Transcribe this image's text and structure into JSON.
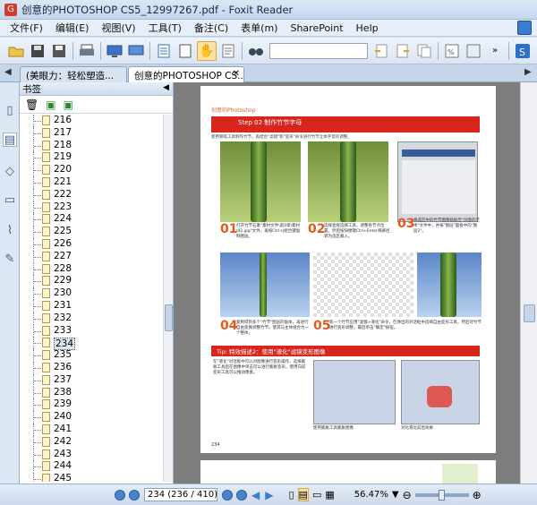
{
  "window": {
    "title": "创意的PHOTOSHOP  CS5_12997267.pdf - Foxit Reader"
  },
  "menu": {
    "items": [
      "文件(F)",
      "编辑(E)",
      "视图(V)",
      "工具(T)",
      "备注(C)",
      "表单(m)",
      "SharePoint",
      "Help"
    ]
  },
  "toolbar": {
    "icons": [
      "open-folder-icon",
      "save-icon",
      "save-as-icon",
      "print-icon",
      "screen-icon",
      "display-icon",
      "document-icon",
      "page-icon",
      "hand-tool-icon",
      "select-text-icon",
      "find-icon",
      "search-input",
      "previous-result-icon",
      "next-result-icon",
      "copy-icon",
      "zoom-in-icon",
      "view-icon",
      "sharepoint-icon"
    ],
    "search_value": ""
  },
  "tabs": [
    {
      "label": "(美眼力：轻松塑造...",
      "active": false
    },
    {
      "label": "创意的PHOTOSHOP  CS...",
      "active": true
    }
  ],
  "bookmarks": {
    "header": "书签",
    "items": [
      "216",
      "217",
      "218",
      "219",
      "220",
      "221",
      "222",
      "223",
      "224",
      "225",
      "226",
      "227",
      "228",
      "229",
      "230",
      "231",
      "232",
      "233",
      "234",
      "235",
      "236",
      "237",
      "238",
      "239",
      "240",
      "241",
      "242",
      "243",
      "244",
      "245"
    ],
    "selected": "234"
  },
  "document": {
    "header_text": "创意的Photoshop",
    "step_title": "Step 02 制作竹节字母",
    "step_subtitle": "使用钢笔工具制作竹节，再结合\"滤镜\"和\"变形\"命令进行竹节立体字母的调整。",
    "steps": [
      {
        "num": "01",
        "text": "打开竹节石素\"素材文件\\第4章\\素材\\02.jpg\"文件，再按Ctrl+J组合键复制图层。"
      },
      {
        "num": "02",
        "text": "选择直接选择工具，调整各节点位置，然后按快捷键Ctrl+Enter将路径转为选区载入。"
      },
      {
        "num": "03",
        "text": "将选区中的竹节图像粘贴至\"创意的艺术\"文件中，并按\"图层\"面板中的\"图层2\"。"
      },
      {
        "num": "04",
        "text": "复制得到多个\"竹节\"图层的副本，再进行自由变换调整竹节，使其与主体组合为一个整体。"
      },
      {
        "num": "05",
        "text": "新一个竹节应用\"滤镜>液化\"命令，在弹出的对话框中选择自由变形工具，然后对竹节进行变形调整，最后单击\"确定\"按钮。"
      }
    ],
    "tip_title": "Tip: 特效描述2：使用\"液化\"滤镜变形图像",
    "tip_text": "在\"液化\"对话框中可以对图像进行变形操作，选择膨胀工具后在图像中单击可以进行膨胀变形，使用向前变形工具可以推动像素。",
    "tip_captions": [
      "使用膨胀工具膨胀图像",
      "对比液化前后效果"
    ],
    "page_number": "234"
  },
  "status": {
    "page_field": "234 (236 / 410)",
    "zoom": "56.47%"
  }
}
